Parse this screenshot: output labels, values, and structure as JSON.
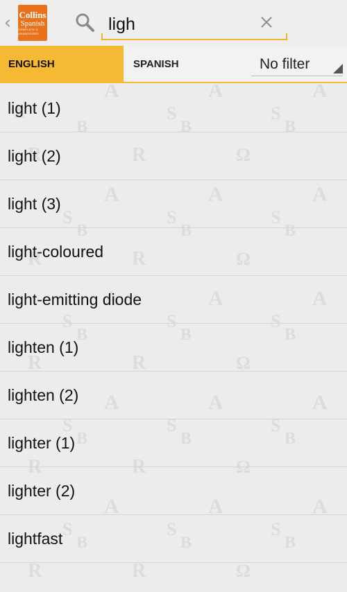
{
  "app": {
    "logo_line1": "Collins",
    "logo_line2": "Spanish",
    "logo_line3": "COMPLETE & UNABRIDGED"
  },
  "search": {
    "value": "ligh"
  },
  "tabs": [
    {
      "label": "ENGLISH",
      "selected": true
    },
    {
      "label": "SPANISH",
      "selected": false
    }
  ],
  "filter": {
    "selected": "No filter"
  },
  "results": [
    "light (1)",
    "light (2)",
    "light (3)",
    "light-coloured",
    "light-emitting diode",
    "lighten (1)",
    "lighten (2)",
    "lighter (1)",
    "lighter (2)",
    "lightfast"
  ],
  "colors": {
    "accent": "#f6b934",
    "logo": "#e8731c",
    "background": "#ececec"
  }
}
